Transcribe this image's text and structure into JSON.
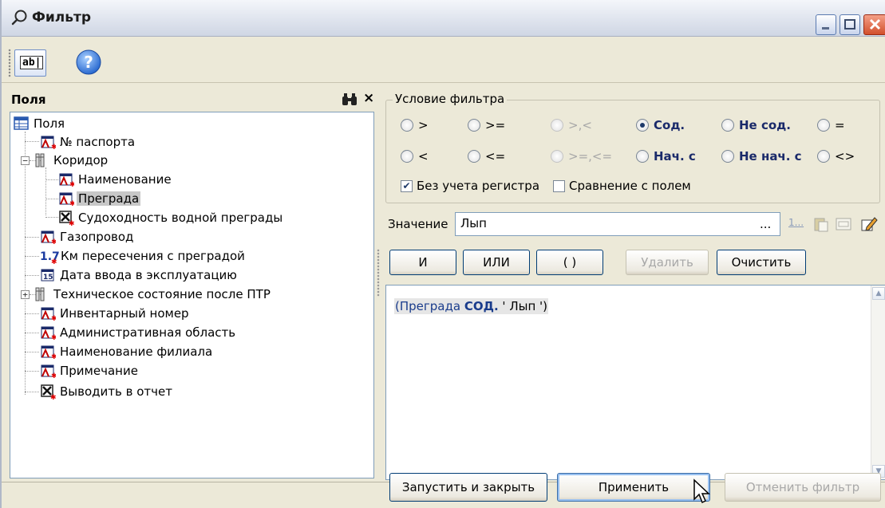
{
  "window": {
    "title": "Фильтр",
    "icons": {
      "title": "search-icon",
      "minimize": "minimize-icon",
      "maximize": "maximize-icon",
      "close": "close-icon"
    }
  },
  "toolbar": {
    "edit_icon_text": "ab|",
    "help_icon": "help-icon"
  },
  "fields_panel": {
    "header": "Поля",
    "search_icon": "binoculars-icon",
    "close_glyph": "×",
    "tree": [
      {
        "label": "Поля",
        "icon": "table-icon",
        "level": 0
      },
      {
        "label": "№ паспорта",
        "icon": "text-field-icon",
        "level": 1
      },
      {
        "label": "Коридор",
        "icon": "group-icon",
        "level": 1,
        "expander": "−"
      },
      {
        "label": "Наименование",
        "icon": "text-field-icon",
        "level": 2
      },
      {
        "label": "Преграда",
        "icon": "text-field-icon",
        "level": 2,
        "selected": true
      },
      {
        "label": "Судоходность водной преграды",
        "icon": "checkbox-field-icon",
        "level": 2
      },
      {
        "label": "Газопровод",
        "icon": "text-field-icon",
        "level": 1
      },
      {
        "label": "Км пересечения  с преградой",
        "icon": "number-field-icon",
        "level": 1
      },
      {
        "label": "Дата ввода в эксплуатацию",
        "icon": "date-field-icon",
        "level": 1
      },
      {
        "label": "Техническое состояние после ПТР",
        "icon": "group-icon",
        "level": 1,
        "expander": "+"
      },
      {
        "label": "Инвентарный номер",
        "icon": "text-field-icon",
        "level": 1
      },
      {
        "label": "Административная область",
        "icon": "text-field-icon",
        "level": 1
      },
      {
        "label": "Наименование филиала",
        "icon": "text-field-icon",
        "level": 1
      },
      {
        "label": "Примечание",
        "icon": "text-field-icon",
        "level": 1
      },
      {
        "label": "Выводить в отчет",
        "icon": "checkbox-field-icon",
        "level": 1
      }
    ],
    "number_icon_text": "1.7",
    "date_icon_text": "15"
  },
  "condition": {
    "group_title": "Условие фильтра",
    "options": [
      {
        "label": ">",
        "state": "normal"
      },
      {
        "label": ">=",
        "state": "normal"
      },
      {
        "label": ">,<",
        "state": "disabled"
      },
      {
        "label": "Сод.",
        "state": "selected"
      },
      {
        "label": "Не сод.",
        "state": "bold"
      },
      {
        "label": "=",
        "state": "normal"
      },
      {
        "label": "<",
        "state": "normal"
      },
      {
        "label": "<=",
        "state": "normal"
      },
      {
        "label": ">=,<=",
        "state": "disabled"
      },
      {
        "label": "Нач. с",
        "state": "bold"
      },
      {
        "label": "Не нач. с",
        "state": "bold"
      },
      {
        "label": "<>",
        "state": "normal"
      }
    ],
    "case_insensitive": {
      "label": "Без учета регистра",
      "checked": true,
      "mark": "✔"
    },
    "compare_with_field": {
      "label": "Сравнение с полем",
      "checked": false
    }
  },
  "value": {
    "label": "Значение",
    "text": "Лып",
    "ellipsis": "...",
    "list_icon_text": "1..."
  },
  "logic_buttons": {
    "and": "И",
    "or": "ИЛИ",
    "parens": "( )",
    "delete": "Удалить",
    "clear": "Очистить"
  },
  "expression": {
    "open": "(",
    "field": "Преграда",
    "op": "СОД.",
    "value": " ' Лып ')"
  },
  "footer": {
    "run_close": "Запустить и закрыть",
    "apply": "Применить",
    "cancel_filter": "Отменить фильтр"
  },
  "colors": {
    "accent": "#1a3c8c",
    "window_bg": "#ece9d8"
  }
}
